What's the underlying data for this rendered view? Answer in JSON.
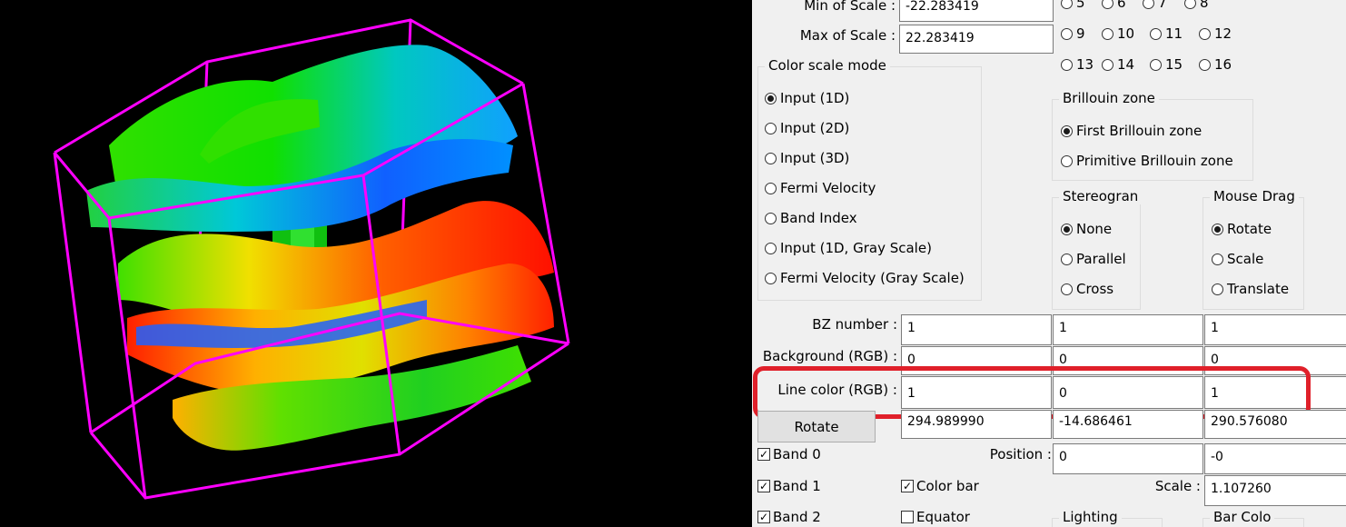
{
  "scale": {
    "min_label": "Min of Scale :",
    "min_value": "-22.283419",
    "max_label": "Max of Scale :",
    "max_value": "22.283419"
  },
  "band_numbers": [
    {
      "label": "5",
      "checked": false
    },
    {
      "label": "6",
      "checked": false
    },
    {
      "label": "7",
      "checked": false
    },
    {
      "label": "8",
      "checked": false
    },
    {
      "label": "9",
      "checked": false
    },
    {
      "label": "10",
      "checked": false
    },
    {
      "label": "11",
      "checked": false
    },
    {
      "label": "12",
      "checked": false
    },
    {
      "label": "13",
      "checked": false
    },
    {
      "label": "14",
      "checked": false
    },
    {
      "label": "15",
      "checked": false
    },
    {
      "label": "16",
      "checked": false
    }
  ],
  "color_scale_mode": {
    "title": "Color scale mode",
    "options": [
      {
        "label": "Input (1D)",
        "checked": true
      },
      {
        "label": "Input (2D)",
        "checked": false
      },
      {
        "label": "Input (3D)",
        "checked": false
      },
      {
        "label": "Fermi Velocity",
        "checked": false
      },
      {
        "label": "Band Index",
        "checked": false
      },
      {
        "label": "Input (1D, Gray Scale)",
        "checked": false
      },
      {
        "label": "Fermi Velocity (Gray Scale)",
        "checked": false
      }
    ]
  },
  "brillouin_zone": {
    "title": "Brillouin zone",
    "options": [
      {
        "label": "First Brillouin zone",
        "checked": true
      },
      {
        "label": "Primitive Brillouin zone",
        "checked": false
      }
    ]
  },
  "stereogram": {
    "title": "Stereogran",
    "options": [
      {
        "label": "None",
        "checked": true
      },
      {
        "label": "Parallel",
        "checked": false
      },
      {
        "label": "Cross",
        "checked": false
      }
    ]
  },
  "mouse_drag": {
    "title": "Mouse Drag",
    "options": [
      {
        "label": "Rotate",
        "checked": true
      },
      {
        "label": "Scale",
        "checked": false
      },
      {
        "label": "Translate",
        "checked": false
      }
    ]
  },
  "bz_number": {
    "label": "BZ number :",
    "values": [
      "1",
      "1",
      "1"
    ]
  },
  "background": {
    "label": "Background (RGB) :",
    "values": [
      "0",
      "0",
      "0"
    ]
  },
  "line_color": {
    "label": "Line color (RGB) :",
    "values": [
      "1",
      "0",
      "1"
    ]
  },
  "rotate": {
    "button": "Rotate",
    "values": [
      "294.989990",
      "-14.686461",
      "290.576080"
    ]
  },
  "bands": [
    {
      "label": "Band 0",
      "checked": true
    },
    {
      "label": "Band 1",
      "checked": true
    },
    {
      "label": "Band 2",
      "checked": true
    }
  ],
  "position": {
    "label": "Position :",
    "values": [
      "0",
      "-0"
    ]
  },
  "color_bar": {
    "label": "Color bar",
    "checked": true
  },
  "equator": {
    "label": "Equator",
    "checked": false
  },
  "scale_field": {
    "label": "Scale :",
    "value": "1.107260"
  },
  "lighting": {
    "title": "Lighting"
  },
  "bar_color": {
    "title": "Bar Colo"
  },
  "colors": {
    "highlight": "#e0202a",
    "bz_wireframe": "#ff00ff",
    "viewport_bg": "#000000"
  }
}
